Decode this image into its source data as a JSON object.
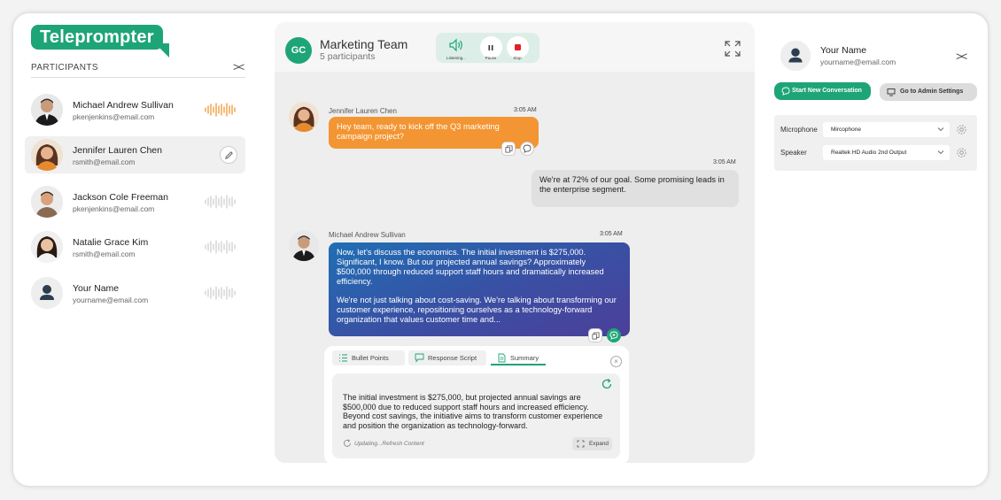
{
  "app": {
    "logo_text": "Teleprompter",
    "brand_color": "#1ea577"
  },
  "sidebar": {
    "section_label": "PARTICIPANTS",
    "collapse_glyph": "><",
    "participants": [
      {
        "name": "Michael Andrew Sullivan",
        "email": "pkenjenkins@email.com",
        "speaking": true
      },
      {
        "name": "Jennifer Lauren Chen",
        "email": "rsmith@email.com",
        "selected": true
      },
      {
        "name": "Jackson Cole Freeman",
        "email": "pkenjenkins@email.com",
        "speaking": false
      },
      {
        "name": "Natalie Grace Kim",
        "email": "rsmith@email.com",
        "speaking": false
      },
      {
        "name": "Your Name",
        "email": "yourname@email.com",
        "speaking": false
      }
    ]
  },
  "conversation": {
    "avatar_initials": "GC",
    "title": "Marketing Team",
    "subtitle": "5 participants",
    "controls": {
      "listening": "Listening...",
      "pause": "Pause",
      "stop": "Stop"
    },
    "messages": [
      {
        "sender": "Jennifer Lauren Chen",
        "time": "3:05 AM",
        "text": "Hey team, ready to kick off the Q3 marketing campaign project?"
      },
      {
        "sender": "",
        "time": "3:05 AM",
        "text": "We're at 72% of our goal. Some promising leads in the enterprise segment."
      },
      {
        "sender": "Michael Andrew Sullivan",
        "time": "3:05 AM",
        "text_p1": "Now, let's discuss the economics. The initial investment is $275,000. Significant, I know. But our projected annual savings? Approximately $500,000 through reduced support staff hours and dramatically increased efficiency.",
        "text_p2": "We're not just talking about cost-saving. We're talking about transforming our customer experience, repositioning ourselves as a technology-forward organization that values customer time and..."
      }
    ],
    "assist": {
      "tabs": [
        "Bullet Points",
        "Response Script",
        "Summary"
      ],
      "active_tab": "Summary",
      "summary": "The initial investment is $275,000, but projected annual savings are $500,000 due to reduced support staff hours and increased efficiency. Beyond cost savings, the initiative aims to transform customer experience and position the organization as technology-forward.",
      "status": "Updating...Refresh Content",
      "expand_label": "Expand"
    }
  },
  "right_panel": {
    "user_name": "Your Name",
    "user_email": "yourname@email.com",
    "collapse_glyph": "><",
    "start_button": "Start New Conversation",
    "admin_button": "Go to Admin Settings",
    "microphone_label": "Microphone",
    "microphone_value": "Mircophone",
    "speaker_label": "Speaker",
    "speaker_value": "Realtek HD Audio 2nd Output"
  }
}
